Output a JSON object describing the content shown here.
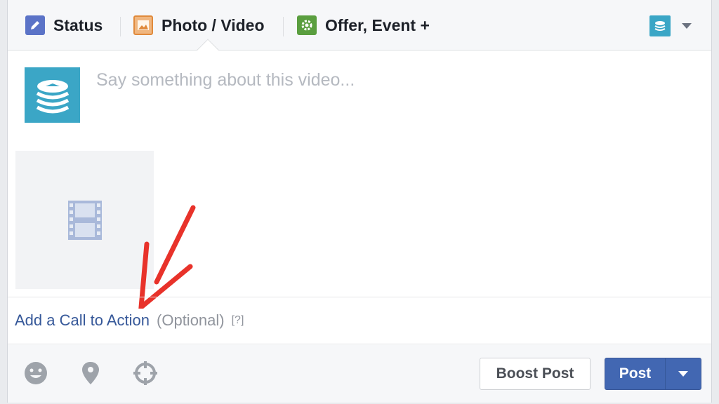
{
  "tabs": {
    "status": "Status",
    "photo_video": "Photo / Video",
    "offer_event": "Offer, Event +"
  },
  "composer": {
    "placeholder": "Say something about this video..."
  },
  "cta": {
    "link": "Add a Call to Action",
    "optional": "(Optional)",
    "help": "[?]"
  },
  "footer": {
    "boost_label": "Boost Post",
    "post_label": "Post"
  },
  "colors": {
    "brand_blue": "#4267b2",
    "page_teal": "#3ba6c6",
    "annotation_red": "#e8322a"
  },
  "icons": {
    "status": "pencil-icon",
    "photo": "photo-icon",
    "offer": "gear-icon",
    "video": "film-icon",
    "feeling": "smiley-icon",
    "location": "location-pin-icon",
    "target": "crosshair-icon"
  }
}
